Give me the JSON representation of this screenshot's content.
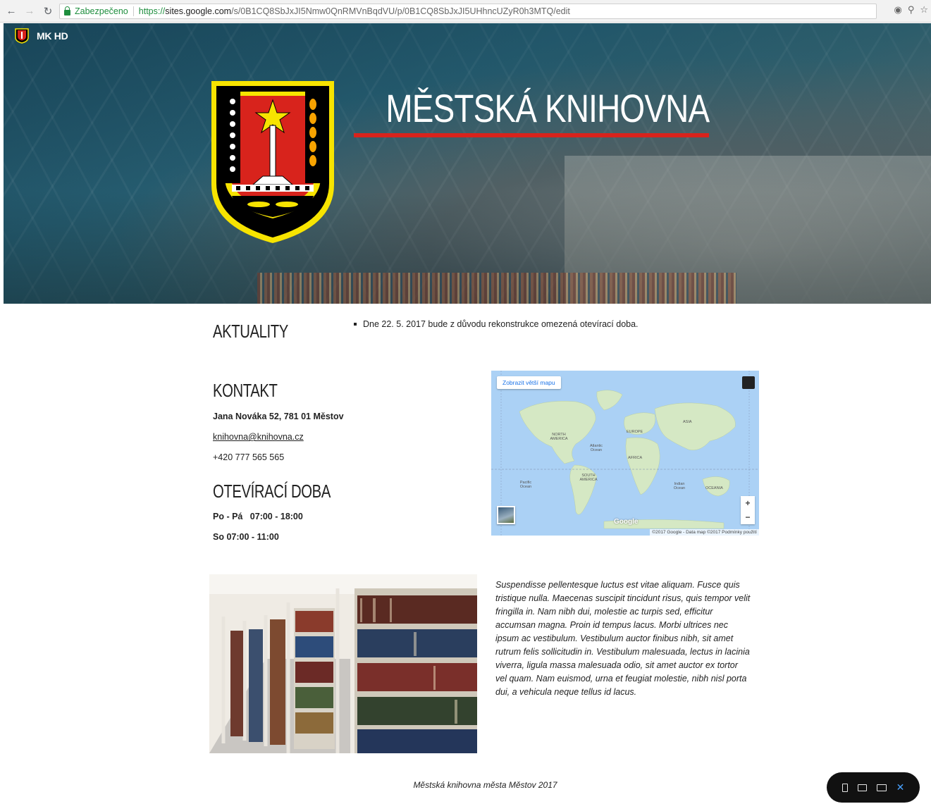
{
  "browser": {
    "secure_label": "Zabezpečeno",
    "url_scheme": "https://",
    "url_host": "sites.google.com",
    "url_path": "/s/0B1CQ8SbJxJI5Nmw0QnRMVnBqdVU/p/0B1CQ8SbJxJI5UHhncUZyR0h3MTQ/edit"
  },
  "site": {
    "name": "MK HD",
    "title": "MĚSTSKÁ KNIHOVNA"
  },
  "news": {
    "heading": "AKTUALITY",
    "items": [
      "Dne 22. 5. 2017 bude z důvodu rekonstrukce omezená otevírací doba."
    ]
  },
  "contact": {
    "heading": "KONTAKT",
    "address": "Jana Nováka 52, 781 01 Městov",
    "email": "knihovna@knihovna.cz",
    "phone": "+420 777 565 565"
  },
  "hours": {
    "heading": "OTEVÍRACÍ DOBA",
    "weekdays": "Po - Pá   07:00 - 18:00",
    "saturday": "So 07:00 - 11:00"
  },
  "map": {
    "bigger_map_label": "Zobrazit větší mapu",
    "zoom_in": "+",
    "zoom_out": "−",
    "google_logo": "Google",
    "copyright": "©2017 Google - Data map ©2017   Podmínky použití",
    "labels": {
      "north_america": "NORTH AMERICA",
      "south_america": "SOUTH AMERICA",
      "europe": "EUROPE",
      "africa": "AFRICA",
      "asia": "ASIA",
      "oceania": "OCEANIA",
      "atlantic": "Atlantic Ocean",
      "pacific": "Pacific Ocean",
      "indian": "Indian Ocean"
    }
  },
  "body_text": "Suspendisse pellentesque luctus est vitae aliquam. Fusce quis tristique nulla. Maecenas suscipit tincidunt risus, quis tempor velit fringilla in. Nam nibh dui, molestie ac turpis sed, efficitur accumsan magna. Proin id tempus lacus. Morbi ultrices nec ipsum ac vestibulum. Vestibulum auctor finibus nibh, sit amet rutrum felis sollicitudin in. Vestibulum malesuada, lectus in lacinia viverra, ligula massa malesuada odio, sit amet auctor ex tortor vel quam. Nam euismod, urna et feugiat molestie, nibh nisl porta dui, a vehicula neque tellus id lacus.",
  "footer": "Městská knihovna města Městov 2017",
  "colors": {
    "accent_red": "#d8231c",
    "emblem_yellow": "#f7e400",
    "secure_green": "#1e8e3e"
  },
  "icons": {
    "back": "arrow-left",
    "forward": "arrow-right",
    "reload": "reload",
    "star": "star",
    "zoom": "magnifier"
  }
}
